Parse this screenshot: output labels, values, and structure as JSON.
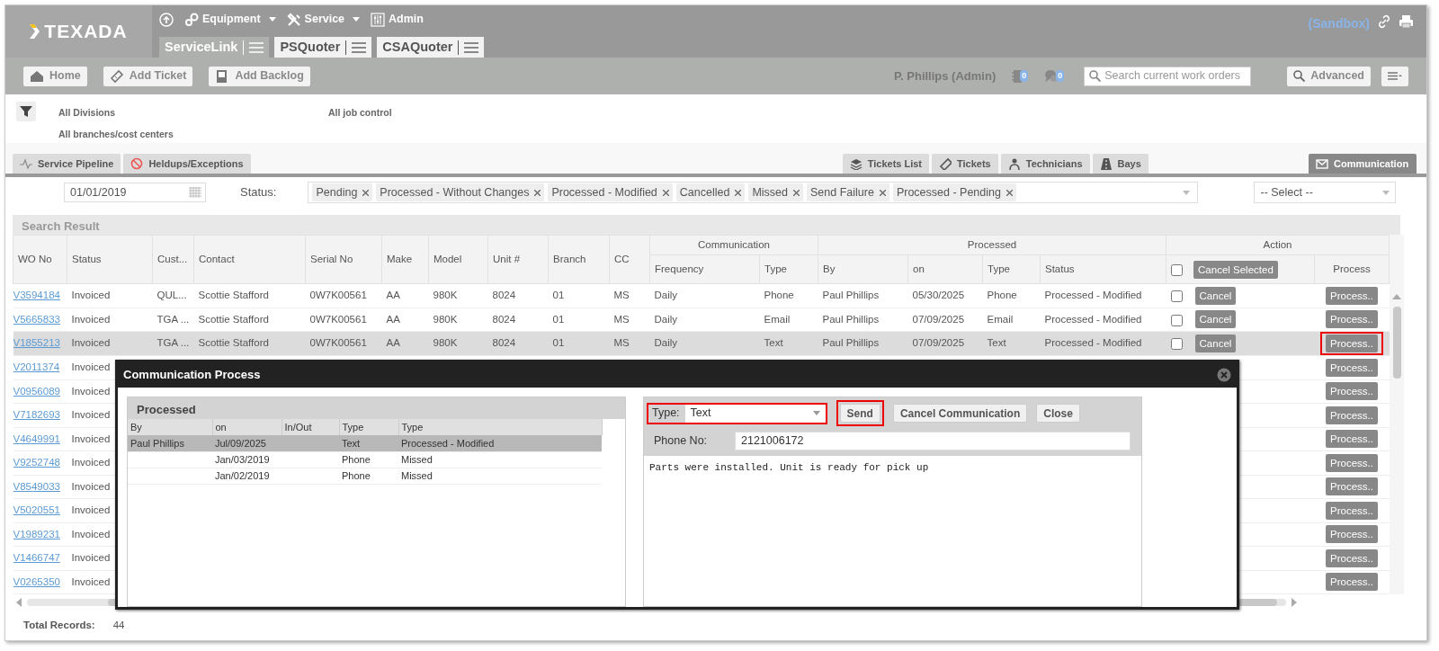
{
  "brand": {
    "name": "TEXADA",
    "environment": "(Sandbox)"
  },
  "top_menu": [
    {
      "label": "Equipment",
      "kind": "dropdown"
    },
    {
      "label": "Service",
      "kind": "dropdown"
    },
    {
      "label": "Admin",
      "kind": "link"
    }
  ],
  "app_tabs": [
    {
      "label": "ServiceLink",
      "selected": true
    },
    {
      "label": "PSQuoter",
      "selected": false
    },
    {
      "label": "CSAQuoter",
      "selected": false
    }
  ],
  "toolbar": {
    "buttons": [
      "Home",
      "Add Ticket",
      "Add Backlog"
    ],
    "user": "P. Phillips (Admin)",
    "notes_count": "0",
    "messages_count": "0",
    "search": {
      "placeholder": "Search current work orders"
    },
    "advanced": "Advanced"
  },
  "filters": {
    "divisions": "All Divisions",
    "job_control": "All job control",
    "branches": "All branches/cost centers"
  },
  "left_tabs": [
    {
      "label": "Service Pipeline",
      "selected": false
    },
    {
      "label": "Heldups/Exceptions",
      "selected": false
    }
  ],
  "center_tabs": [
    {
      "label": "Tickets List",
      "selected": false
    },
    {
      "label": "Tickets",
      "selected": false
    },
    {
      "label": "Technicians",
      "selected": false
    },
    {
      "label": "Bays",
      "selected": false
    }
  ],
  "right_tabs": [
    {
      "label": "Communication",
      "selected": true
    }
  ],
  "search_form": {
    "date": "01/01/2019",
    "status_label": "Status:",
    "status_tags": [
      "Pending",
      "Processed - Without Changes",
      "Processed - Modified",
      "Cancelled",
      "Missed",
      "Send Failure",
      "Processed - Pending"
    ],
    "select_placeholder": "-- Select --"
  },
  "results": {
    "title": "Search Result",
    "columns": [
      "WO No",
      "Status",
      "Cust...",
      "Contact",
      "Serial No",
      "Make",
      "Model",
      "Unit #",
      "Branch",
      "CC"
    ],
    "groups": [
      {
        "label": "Communication",
        "columns": [
          "Frequency",
          "Type"
        ]
      },
      {
        "label": "Processed",
        "columns": [
          "By",
          "on",
          "Type",
          "Status"
        ]
      }
    ],
    "action": {
      "label": "Action",
      "select_all_checked": false,
      "cancel_selected": "Cancel Selected",
      "process_column": "Process"
    },
    "rows": [
      {
        "wo_no": "V3594184",
        "status": "Invoiced",
        "customer": "QUL...",
        "contact": "Scottie Stafford",
        "serial": "0W7K00561",
        "make": "AA",
        "model": "980K",
        "unit": "8024",
        "branch": "01",
        "cc": "MS",
        "frequency": "Daily",
        "comm_type": "Phone",
        "by": "Paul Phillips",
        "on": "05/30/2025",
        "proc_type": "Phone",
        "proc_status": "Processed - Modified",
        "checked": false,
        "cancel": "Cancel",
        "process": "Process..",
        "selected": false,
        "highlighted": false
      },
      {
        "wo_no": "V5665833",
        "status": "Invoiced",
        "customer": "TGA ...",
        "contact": "Scottie Stafford",
        "serial": "0W7K00561",
        "make": "AA",
        "model": "980K",
        "unit": "8024",
        "branch": "01",
        "cc": "MS",
        "frequency": "Daily",
        "comm_type": "Email",
        "by": "Paul Phillips",
        "on": "07/09/2025",
        "proc_type": "Email",
        "proc_status": "Processed - Modified",
        "checked": false,
        "cancel": "Cancel",
        "process": "Process..",
        "selected": false,
        "highlighted": false
      },
      {
        "wo_no": "V1855213",
        "status": "Invoiced",
        "customer": "TGA ...",
        "contact": "Scottie Stafford",
        "serial": "0W7K00561",
        "make": "AA",
        "model": "980K",
        "unit": "8024",
        "branch": "01",
        "cc": "MS",
        "frequency": "Daily",
        "comm_type": "Text",
        "by": "Paul Phillips",
        "on": "07/09/2025",
        "proc_type": "Text",
        "proc_status": "Processed - Modified",
        "checked": false,
        "cancel": "Cancel",
        "process": "Process..",
        "selected": true,
        "highlighted": true
      },
      {
        "wo_no": "V2011374",
        "status": "Invoiced",
        "process": "Process..",
        "selected": false,
        "highlighted": false
      },
      {
        "wo_no": "V0956089",
        "status": "Invoiced",
        "process": "Process..",
        "selected": false,
        "highlighted": false
      },
      {
        "wo_no": "V7182693",
        "status": "Invoiced",
        "process": "Process..",
        "selected": false,
        "highlighted": false
      },
      {
        "wo_no": "V4649991",
        "status": "Invoiced",
        "process": "Process..",
        "selected": false,
        "highlighted": false
      },
      {
        "wo_no": "V9252748",
        "status": "Invoiced",
        "process": "Process..",
        "selected": false,
        "highlighted": false
      },
      {
        "wo_no": "V8549033",
        "status": "Invoiced",
        "process": "Process..",
        "selected": false,
        "highlighted": false
      },
      {
        "wo_no": "V5020551",
        "status": "Invoiced",
        "process": "Process..",
        "selected": false,
        "highlighted": false
      },
      {
        "wo_no": "V1989231",
        "status": "Invoiced",
        "process": "Process..",
        "selected": false,
        "highlighted": false
      },
      {
        "wo_no": "V1466747",
        "status": "Invoiced",
        "process": "Process..",
        "selected": false,
        "highlighted": false
      },
      {
        "wo_no": "V0265350",
        "status": "Invoiced",
        "process": "Process..",
        "selected": false,
        "highlighted": false
      }
    ],
    "total_label": "Total Records:",
    "total": "44"
  },
  "modal": {
    "title": "Communication Process",
    "history": {
      "title": "Processed",
      "columns": [
        "By",
        "on",
        "In/Out",
        "Type",
        "Type"
      ],
      "rows": [
        {
          "by": "Paul Phillips",
          "on": "Jul/09/2025",
          "type": "Text",
          "status": "Processed - Modified",
          "selected": true
        },
        {
          "on": "Jan/03/2019",
          "type": "Phone",
          "status": "Missed",
          "selected": false
        },
        {
          "on": "Jan/02/2019",
          "type": "Phone",
          "status": "Missed",
          "selected": false
        }
      ]
    },
    "form": {
      "type_label": "Type:",
      "type_value": "Text",
      "type_highlighted": true,
      "buttons": [
        {
          "label": "Send",
          "highlighted": true
        },
        {
          "label": "Cancel Communication",
          "highlighted": false
        },
        {
          "label": "Close",
          "highlighted": false
        }
      ],
      "phone_label": "Phone No:",
      "phone": "2121006172",
      "message": "Parts were installed. Unit is ready for pick up"
    }
  }
}
